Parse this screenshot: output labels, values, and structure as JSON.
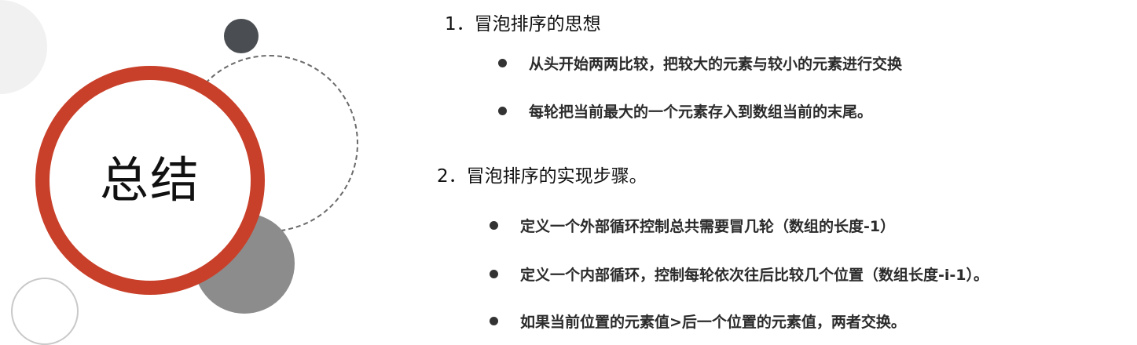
{
  "badge": {
    "label": "总结"
  },
  "sections": [
    {
      "heading": "1．冒泡排序的思想",
      "bullets": [
        "从头开始两两比较，把较大的元素与较小的元素进行交换",
        "每轮把当前最大的一个元素存入到数组当前的末尾。"
      ]
    },
    {
      "heading": "2．冒泡排序的实现步骤。",
      "bullets": [
        "定义一个外部循环控制总共需要冒几轮（数组的长度-1）",
        "定义一个内部循环，控制每轮依次往后比较几个位置（数组长度-i-1）。",
        "如果当前位置的元素值>后一个位置的元素值，两者交换。"
      ]
    }
  ],
  "colors": {
    "accent_ring": "#c9402a",
    "dark_dot": "#4a4d51",
    "gray_disk": "#8c8c8c"
  }
}
